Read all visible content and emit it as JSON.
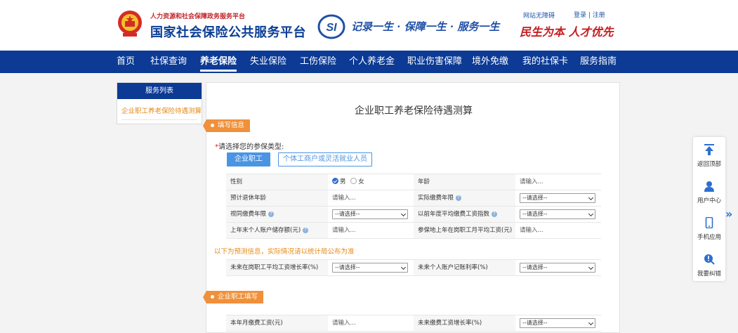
{
  "header": {
    "subtitle": "人力资源和社会保障政务服务平台",
    "title": "国家社会保险公共服务平台",
    "si_logo_text": "SI",
    "slogan": "记录一生 · 保障一生 · 服务一生",
    "accessibility": "网站无障碍",
    "login": "登录 | 注册",
    "motto": "民生为本 人才优先"
  },
  "nav": {
    "items": [
      "首页",
      "社保查询",
      "养老保险",
      "失业保险",
      "工伤保险",
      "个人养老金",
      "职业伤害保障",
      "境外免缴",
      "我的社保卡",
      "服务指南"
    ],
    "active_index": 2
  },
  "sidebar": {
    "heading": "服务列表",
    "items": [
      "企业职工养老保险待遇测算"
    ]
  },
  "main": {
    "title": "企业职工养老保险待遇测算",
    "section1": "填写信息",
    "type_label_req": "*",
    "type_label": "请选择您的参保类型:",
    "type_options": [
      "企业职工",
      "个体工商户或灵活就业人员"
    ],
    "rows": {
      "gender_label": "性别",
      "gender_male": "男",
      "gender_female": "女",
      "age_label": "年龄",
      "age_ph": "请输入...",
      "retire_age_label": "预计退休年龄",
      "retire_age_ph": "请输入...",
      "actual_years_label": "实际缴费年限",
      "actual_years_sel": "--请选择--",
      "deemed_years_label": "视同缴费年限",
      "deemed_years_sel": "--请选择--",
      "avg_index_label": "以前年度平均缴费工资指数",
      "avg_index_sel": "--请选择--",
      "last_balance_label": "上年末个人账户储存额(元)",
      "last_balance_ph": "请输入...",
      "last_avg_wage_label": "参保地上年在岗职工月平均工资(元)",
      "last_avg_wage_ph": "请输入..."
    },
    "notice": "以下为预测信息，实际情况请以统计局公布为准",
    "forecast": {
      "wage_growth_label": "未来在岗职工平均工资增长率(%)",
      "wage_growth_sel": "--请选择--",
      "interest_label": "未来个人账户记账利率(%)",
      "interest_sel": "--请选择--"
    },
    "section2": "企业职工填写",
    "employee": {
      "monthly_wage_label": "本年月缴费工资(元)",
      "monthly_wage_ph": "请输入...",
      "wage_growth_label": "未来缴费工资增长率(%)",
      "wage_growth_sel": "--请选择--"
    }
  },
  "float_bar": {
    "items": [
      "返回顶部",
      "用户中心",
      "手机应用",
      "我要纠错"
    ]
  },
  "colors": {
    "nav_bg": "#0c3a94",
    "accent_orange": "#f0903a",
    "primary_blue": "#4a94e4",
    "motto_red": "#c41d22"
  }
}
